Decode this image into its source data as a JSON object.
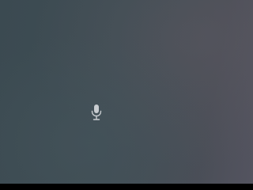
{
  "screen": {
    "background_colors": [
      "#3b4a51",
      "#3f4d54",
      "#4a4e57",
      "#545460"
    ]
  },
  "mic_button": {
    "icon": "microphone-icon",
    "color": "#c8ccd0"
  },
  "bottom_bar": {
    "color": "#000000"
  }
}
